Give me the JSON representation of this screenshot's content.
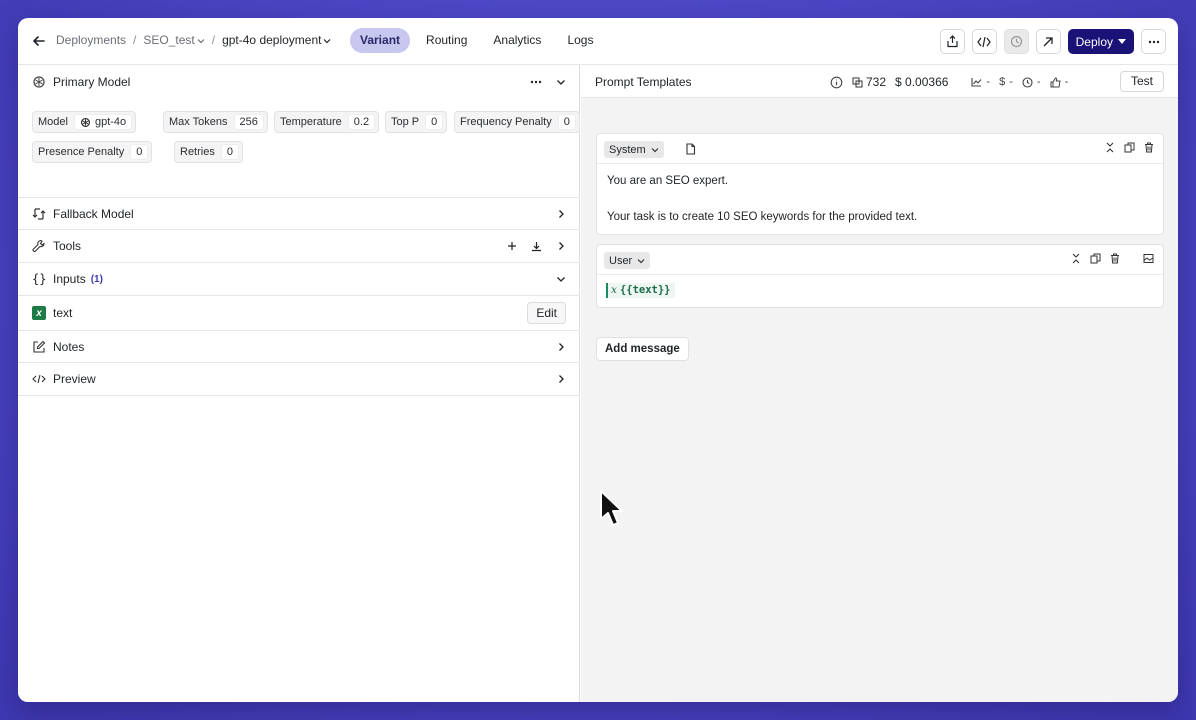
{
  "header": {
    "breadcrumbs": [
      "Deployments",
      "SEO_test",
      "gpt-4o deployment"
    ],
    "separator": "/",
    "tabs": [
      {
        "label": "Variant",
        "active": true
      },
      {
        "label": "Routing",
        "active": false
      },
      {
        "label": "Analytics",
        "active": false
      },
      {
        "label": "Logs",
        "active": false
      }
    ],
    "deploy_label": "Deploy",
    "accent_color": "#1a1277"
  },
  "left": {
    "primary_model": {
      "title": "Primary Model",
      "params": [
        {
          "label": "Model",
          "value": "gpt-4o"
        },
        {
          "label": "Max Tokens",
          "value": "256"
        },
        {
          "label": "Temperature",
          "value": "0.2"
        },
        {
          "label": "Top P",
          "value": "0"
        },
        {
          "label": "Frequency Penalty",
          "value": "0"
        },
        {
          "label": "Presence Penalty",
          "value": "0"
        },
        {
          "label": "Retries",
          "value": "0"
        }
      ]
    },
    "fallback_title": "Fallback Model",
    "tools_title": "Tools",
    "inputs_title": "Inputs",
    "inputs_count": "(1)",
    "input_name": "text",
    "edit_label": "Edit",
    "notes_title": "Notes",
    "preview_title": "Preview"
  },
  "right": {
    "title": "Prompt Templates",
    "tokens": "732",
    "cost": "$ 0.00366",
    "metric_placeholder": "-",
    "test_label": "Test",
    "messages": [
      {
        "role": "System",
        "lines": [
          "You are an SEO expert.",
          "",
          "Your task is to create 10 SEO keywords for the provided text."
        ]
      },
      {
        "role": "User",
        "variable": "{{text}}"
      }
    ],
    "add_message_label": "Add message"
  }
}
